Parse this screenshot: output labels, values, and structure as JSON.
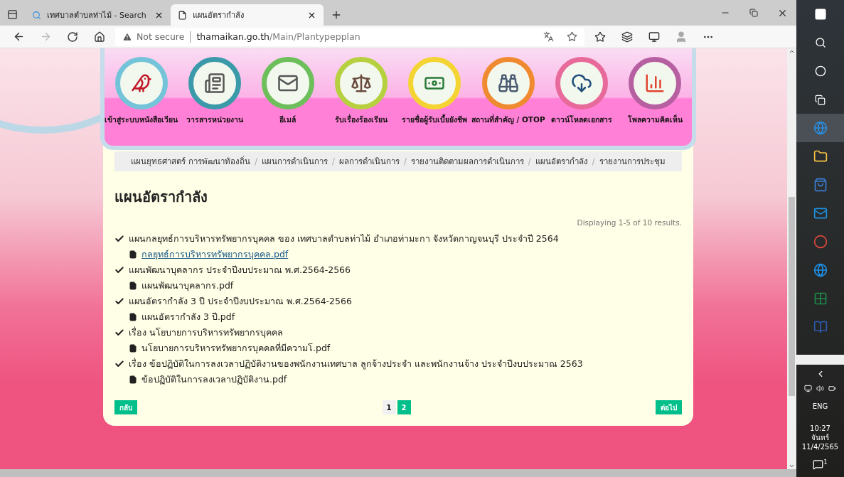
{
  "browser": {
    "tabs": [
      {
        "title": "เทศบาลตำบลท่าไม้ - Search",
        "selected": false
      },
      {
        "title": "แผนอัตรากำลัง",
        "selected": true
      }
    ],
    "address": {
      "warning": "Not secure",
      "host": "thamaikan.go.th",
      "path": "/Main/Plantypepplan"
    }
  },
  "menu": [
    {
      "label": "เข้าสู่ระบบหนังสือเวียน",
      "color": "#74c4d9"
    },
    {
      "label": "วารสารหน่วยงาน",
      "color": "#3b9aa9"
    },
    {
      "label": "อีเมล์",
      "color": "#6dbf5c"
    },
    {
      "label": "รับเรื่องร้องเรียน",
      "color": "#b7d03f"
    },
    {
      "label": "รายชื่อผู้รับเบี้ยยังชีพ",
      "color": "#f4d433"
    },
    {
      "label": "สถานที่สำคัญ / OTOP",
      "color": "#f08a30"
    },
    {
      "label": "ดาวน์โหลดเอกสาร",
      "color": "#e86a9b"
    },
    {
      "label": "โพลความคิดเห็น",
      "color": "#b660a2"
    }
  ],
  "breadcrumb": {
    "separator": "/",
    "items": [
      "แผนยุทธศาสตร์ การพัฒนาท้องถิ่น",
      "แผนการดำเนินการ",
      "ผลการดำเนินการ",
      "รายงานติดตามผลการดำเนินการ",
      "แผนอัตรากำลัง",
      "รายงานการประชุม"
    ]
  },
  "heading": "แผนอัตรากำลัง",
  "summary": "Displaying 1-5 of 10 results.",
  "documents": [
    {
      "title": "แผนกลยุทธ์การบริหารทรัพยากรบุคคล ของ เทศบาลตำบลท่าไม้ อำเภอท่ามะกา จังหวัดกาญจนบุรี ประจำปี 2564",
      "file": "กลยุทธ์การบริหารทรัพยากรบุคคล.pdf",
      "hovered": true
    },
    {
      "title": "แผนพัฒนาบุคลากร ประจำปีงบประมาณ พ.ศ.2564-2566",
      "file": "แผนพัฒนาบุคลากร.pdf",
      "hovered": false
    },
    {
      "title": "แผนอัตรากำลัง 3 ปี ประจำปีงบประมาณ พ.ศ.2564-2566",
      "file": "แผนอัตรากำลัง 3 ปี.pdf",
      "hovered": false
    },
    {
      "title": "เรื่อง นโยบายการบริหารทรัพยากรบุคคล",
      "file": "นโยบายการบริหารทรัพยากรบุคคลที่มีความโ.pdf",
      "hovered": false
    },
    {
      "title": "เรื่อง ข้อปฏิบัติในการลงเวลาปฏิบัติงานของพนักงานเทศบาล ลูกจ้างประจำ และพนักงานจ้าง ประจำปีงบประมาณ 2563",
      "file": "ข้อปฏิบัติในการลงเวลาปฏิบัติงาน.pdf",
      "hovered": false
    }
  ],
  "pager": {
    "prev": "กลับ",
    "next": "ต่อไป",
    "pages": [
      {
        "label": "1",
        "selected": true
      },
      {
        "label": "2",
        "selected": false
      }
    ]
  },
  "tray": {
    "language": "ENG",
    "time": "10:27",
    "day": "จันทร์",
    "date": "11/4/2565",
    "notifications": "1"
  }
}
